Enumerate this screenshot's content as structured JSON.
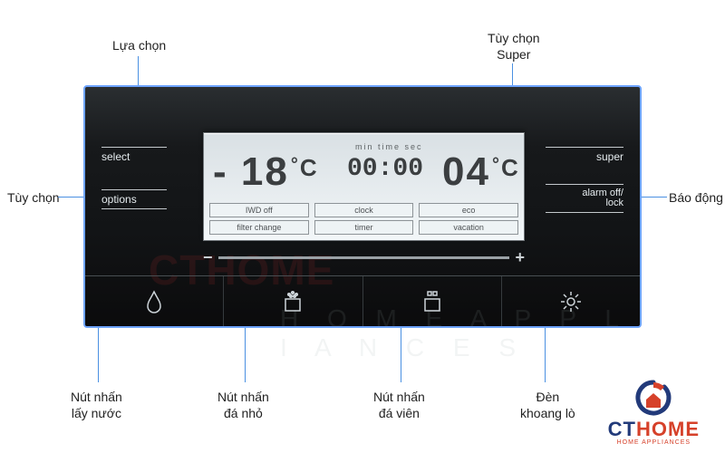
{
  "callouts": {
    "select": "Lựa chọn",
    "options": "Tùy chọn",
    "super": "Tùy chọn\nSuper",
    "alarm": "Báo động",
    "water": "Nút nhấn\nlấy nước",
    "crushed": "Nút nhấn\nđá nhỏ",
    "cubed": "Nút nhấn\nđá viên",
    "light": "Đèn\nkhoang lò"
  },
  "panel": {
    "left": {
      "select": "select",
      "options": "options"
    },
    "right": {
      "super": "super",
      "alarm": "alarm off/\nlock"
    },
    "lcd": {
      "freezer_temp": "- 18",
      "fridge_temp": "04",
      "degree": "°",
      "c": "C",
      "time_labels": "min  time  sec",
      "time": "00:00",
      "options": {
        "col1": [
          "IWD off",
          "filter change"
        ],
        "col2": [
          "clock",
          "timer"
        ],
        "col3": [
          "eco",
          "vacation"
        ]
      }
    },
    "slider": {
      "minus": "−",
      "plus": "+"
    }
  },
  "logo": {
    "ct": "CT",
    "home": "HOME",
    "tag": "HOME APPLIANCES"
  },
  "watermark": {
    "a": "CTHOME",
    "b": "H O M E   A P P L I A N C E S"
  }
}
